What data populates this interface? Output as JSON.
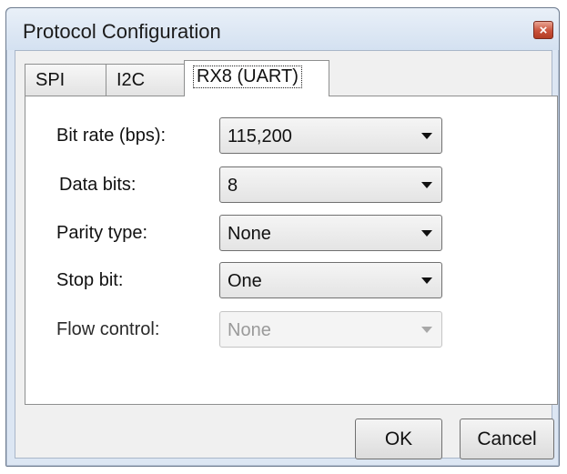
{
  "window": {
    "title": "Protocol Configuration",
    "close_glyph": "×"
  },
  "tabs": [
    {
      "label": "SPI",
      "selected": false
    },
    {
      "label": "I2C",
      "selected": false
    },
    {
      "label": "RX8 (UART)",
      "selected": true
    }
  ],
  "fields": [
    {
      "label": "Bit rate (bps):",
      "value": "115,200",
      "enabled": true
    },
    {
      "label": "Data bits:",
      "value": "8",
      "enabled": true
    },
    {
      "label": "Parity type:",
      "value": "None",
      "enabled": true
    },
    {
      "label": "Stop bit:",
      "value": "One",
      "enabled": true
    },
    {
      "label": "Flow control:",
      "value": "None",
      "enabled": false
    }
  ],
  "buttons": {
    "ok_label": "OK",
    "cancel_label": "Cancel"
  }
}
